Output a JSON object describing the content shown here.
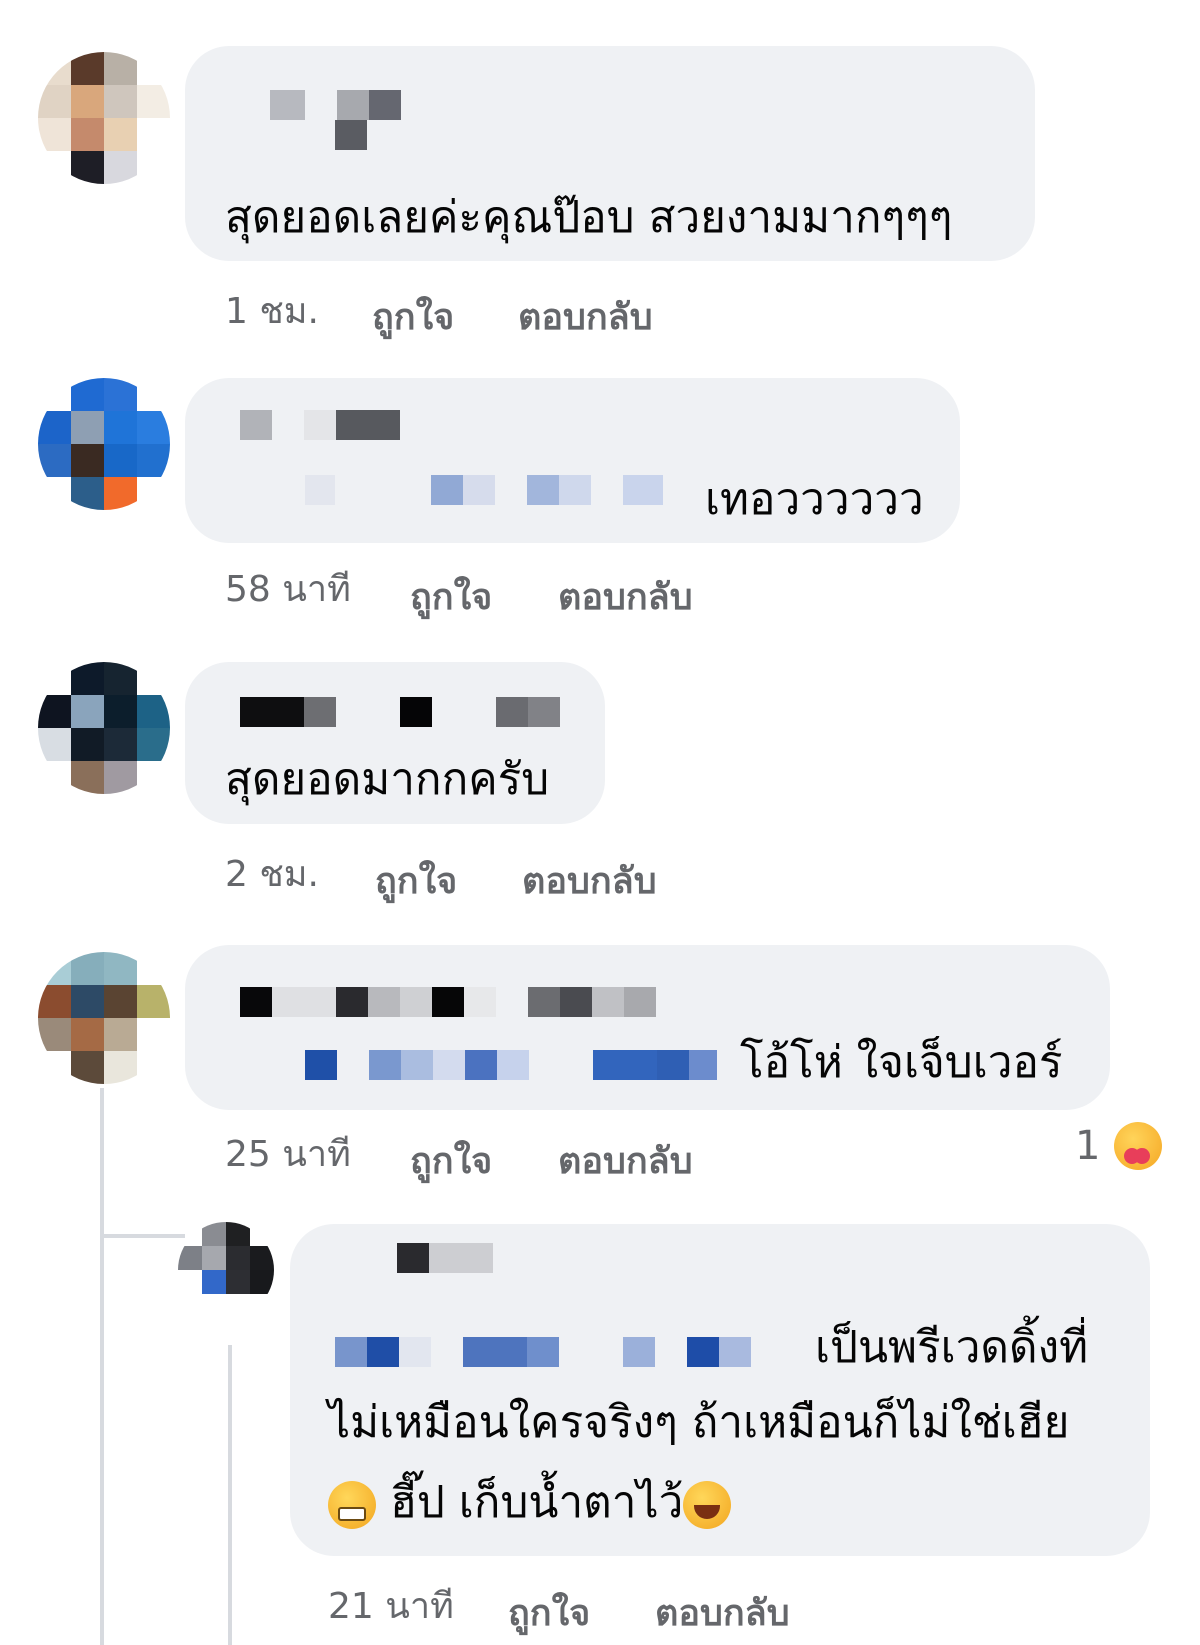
{
  "comments": [
    {
      "text": "สุดยอดเลยค่ะคุณป๊อบ สวยงามมากๆๆๆ",
      "time": "1 ชม.",
      "like": "ถูกใจ",
      "reply": "ตอบกลับ"
    },
    {
      "text": "เทอวววววว",
      "time": "58 นาที",
      "like": "ถูกใจ",
      "reply": "ตอบกลับ"
    },
    {
      "text": "สุดยอดมากกครับ",
      "time": "2 ชม.",
      "like": "ถูกใจ",
      "reply": "ตอบกลับ"
    },
    {
      "text": "โอ้โห่ ใจเจ็บเวอร์",
      "time": "25 นาที",
      "like": "ถูกใจ",
      "reply": "ตอบกลับ",
      "reaction_count": "1",
      "reaction_icon": "care-hug-icon"
    }
  ],
  "reply": {
    "line1": "เป็นพรีเวดดิ้งที่",
    "line2": "ไม่เหมือนใครจริงๆ  ถ้าเหมือนก็ไม่ใช่เฮีย",
    "line3_a": "ฮี๊ป เก็บน้ำตาไว้",
    "time": "21 นาที",
    "like": "ถูกใจ",
    "reply": "ตอบกลับ"
  },
  "colors": {
    "bubble": "#eff1f4",
    "meta": "#65676b",
    "text": "#050505"
  }
}
